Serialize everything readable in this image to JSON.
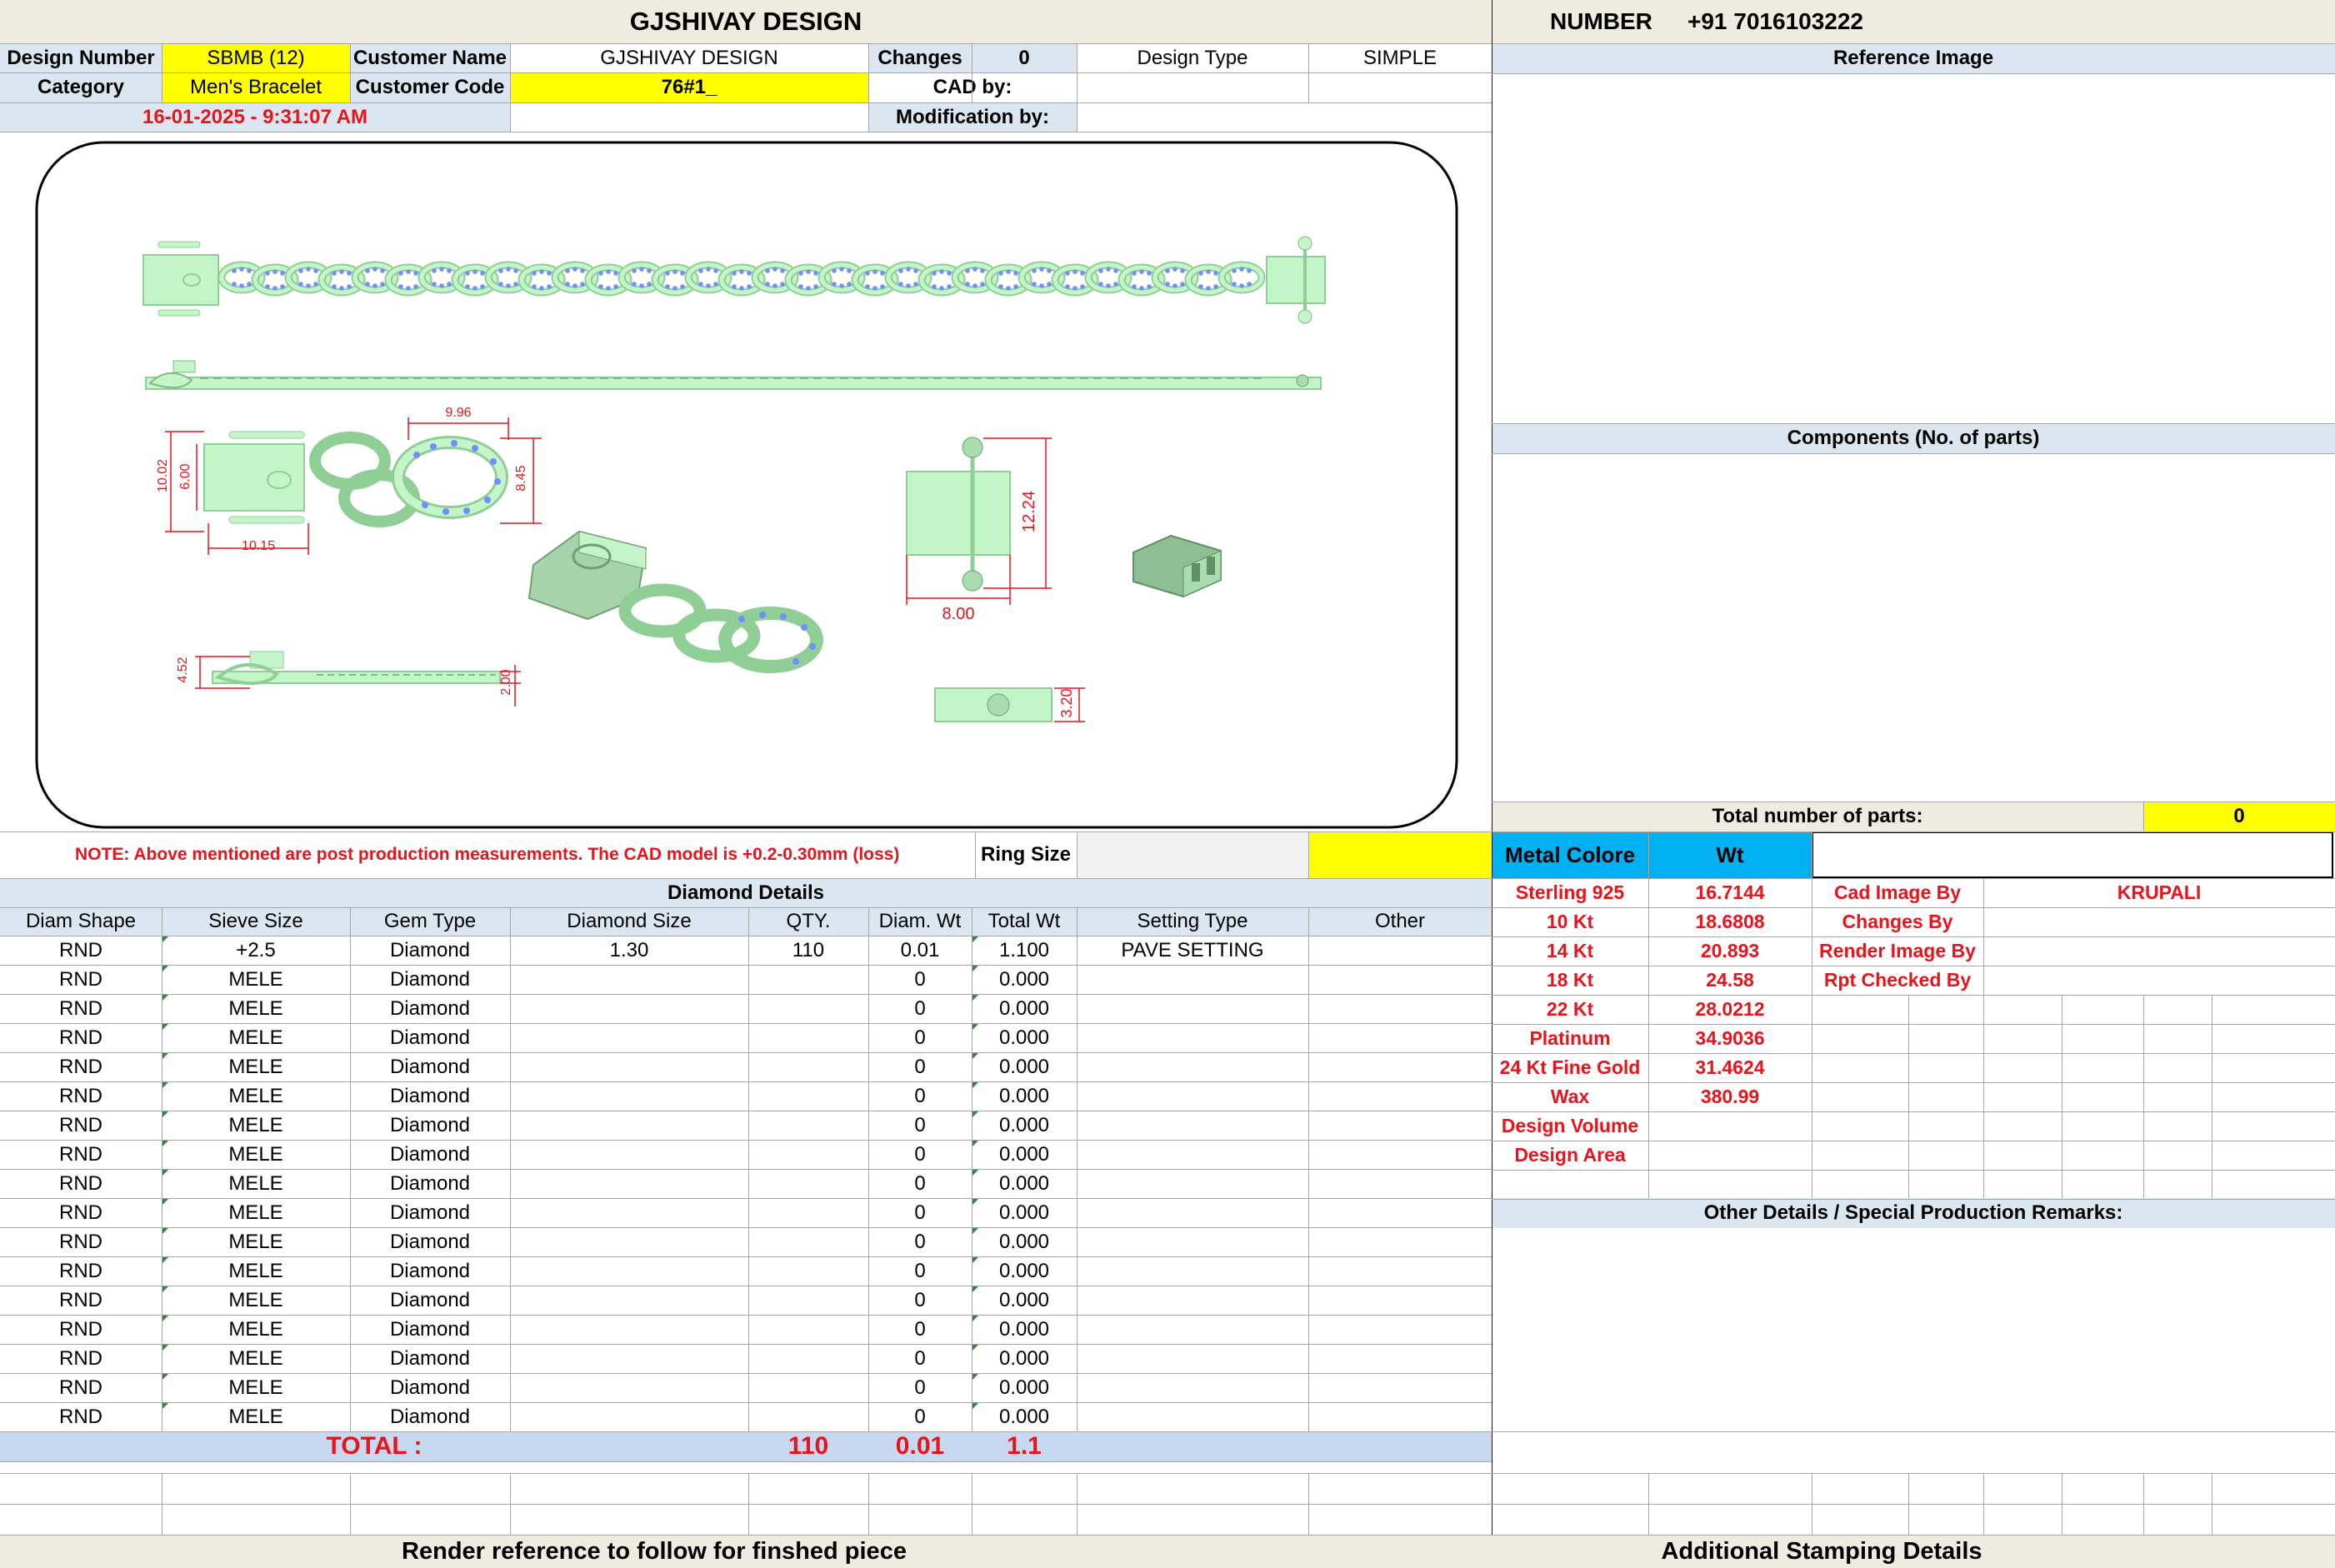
{
  "header": {
    "title": "GJSHIVAY DESIGN",
    "number_label": "NUMBER",
    "number_value": "+91 7016103222"
  },
  "info": {
    "design_number_label": "Design Number",
    "design_number": "SBMB (12)",
    "customer_name_label": "Customer Name",
    "customer_name": "GJSHIVAY DESIGN",
    "changes_label": "Changes",
    "changes": "0",
    "design_type_label": "Design Type",
    "design_type": "SIMPLE",
    "category_label": "Category",
    "category": "Men's Bracelet",
    "customer_code_label": "Customer Code",
    "customer_code": "76#1_",
    "cad_by_label": "CAD by:",
    "timestamp": "16-01-2025 - 9:31:07 AM",
    "modification_by_label": "Modification by:"
  },
  "drawing": {
    "dims": [
      "9.96",
      "10.02",
      "6.00",
      "8.45",
      "10.15",
      "12.24",
      "8.00",
      "4.52",
      "2.00",
      "3.20"
    ]
  },
  "right_panel": {
    "reference_image": "Reference Image",
    "components": "Components (No. of parts)",
    "total_parts_label": "Total number of parts:",
    "total_parts": "0",
    "metal_colore": "Metal Colore",
    "wt": "Wt",
    "metals": [
      {
        "name": "Sterling 925",
        "wt": "16.7144"
      },
      {
        "name": "10 Kt",
        "wt": "18.6808"
      },
      {
        "name": "14 Kt",
        "wt": "20.893"
      },
      {
        "name": "18 Kt",
        "wt": "24.58"
      },
      {
        "name": "22 Kt",
        "wt": "28.0212"
      },
      {
        "name": "Platinum",
        "wt": "34.9036"
      },
      {
        "name": "24 Kt Fine Gold",
        "wt": "31.4624"
      },
      {
        "name": "Wax",
        "wt": "380.99"
      },
      {
        "name": "Design Volume",
        "wt": ""
      },
      {
        "name": "Design Area",
        "wt": ""
      }
    ],
    "roles": [
      {
        "label": "Cad Image By",
        "value": "KRUPALI"
      },
      {
        "label": "Changes By",
        "value": ""
      },
      {
        "label": "Render Image By",
        "value": ""
      },
      {
        "label": "Rpt Checked By",
        "value": ""
      }
    ],
    "other_details": "Other Details / Special Production Remarks:"
  },
  "note": "NOTE: Above mentioned are post production measurements. The CAD model is +0.2-0.30mm (loss)",
  "ring_size_label": "Ring Size",
  "diamond": {
    "title": "Diamond Details",
    "headers": [
      "Diam Shape",
      "Sieve Size",
      "Gem Type",
      "Diamond Size",
      "QTY.",
      "Diam. Wt",
      "Total Wt",
      "Setting Type",
      "Other"
    ],
    "rows": [
      [
        "RND",
        "+2.5",
        "Diamond",
        "1.30",
        "110",
        "0.01",
        "1.100",
        "PAVE SETTING",
        ""
      ],
      [
        "RND",
        "MELE",
        "Diamond",
        "",
        "",
        "0",
        "0.000",
        "",
        ""
      ],
      [
        "RND",
        "MELE",
        "Diamond",
        "",
        "",
        "0",
        "0.000",
        "",
        ""
      ],
      [
        "RND",
        "MELE",
        "Diamond",
        "",
        "",
        "0",
        "0.000",
        "",
        ""
      ],
      [
        "RND",
        "MELE",
        "Diamond",
        "",
        "",
        "0",
        "0.000",
        "",
        ""
      ],
      [
        "RND",
        "MELE",
        "Diamond",
        "",
        "",
        "0",
        "0.000",
        "",
        ""
      ],
      [
        "RND",
        "MELE",
        "Diamond",
        "",
        "",
        "0",
        "0.000",
        "",
        ""
      ],
      [
        "RND",
        "MELE",
        "Diamond",
        "",
        "",
        "0",
        "0.000",
        "",
        ""
      ],
      [
        "RND",
        "MELE",
        "Diamond",
        "",
        "",
        "0",
        "0.000",
        "",
        ""
      ],
      [
        "RND",
        "MELE",
        "Diamond",
        "",
        "",
        "0",
        "0.000",
        "",
        ""
      ],
      [
        "RND",
        "MELE",
        "Diamond",
        "",
        "",
        "0",
        "0.000",
        "",
        ""
      ],
      [
        "RND",
        "MELE",
        "Diamond",
        "",
        "",
        "0",
        "0.000",
        "",
        ""
      ],
      [
        "RND",
        "MELE",
        "Diamond",
        "",
        "",
        "0",
        "0.000",
        "",
        ""
      ],
      [
        "RND",
        "MELE",
        "Diamond",
        "",
        "",
        "0",
        "0.000",
        "",
        ""
      ],
      [
        "RND",
        "MELE",
        "Diamond",
        "",
        "",
        "0",
        "0.000",
        "",
        ""
      ],
      [
        "RND",
        "MELE",
        "Diamond",
        "",
        "",
        "0",
        "0.000",
        "",
        ""
      ],
      [
        "RND",
        "MELE",
        "Diamond",
        "",
        "",
        "0",
        "0.000",
        "",
        ""
      ]
    ],
    "total_label": "TOTAL :",
    "total_qty": "110",
    "total_diam_wt": "0.01",
    "total_wt": "1.1"
  },
  "footer": {
    "render_reference": "Render reference to follow for finshed piece",
    "stamping": "Additional Stamping Details"
  },
  "colors": {
    "yellow": "#ffff00",
    "header_fill": "#eeece1",
    "pale_blue": "#dce6f1",
    "total_fill": "#c6d9f1",
    "cyan": "#00b0f0",
    "red": "#e8141b",
    "mint": "#c3f5c8",
    "stone": "#6f8fff"
  }
}
